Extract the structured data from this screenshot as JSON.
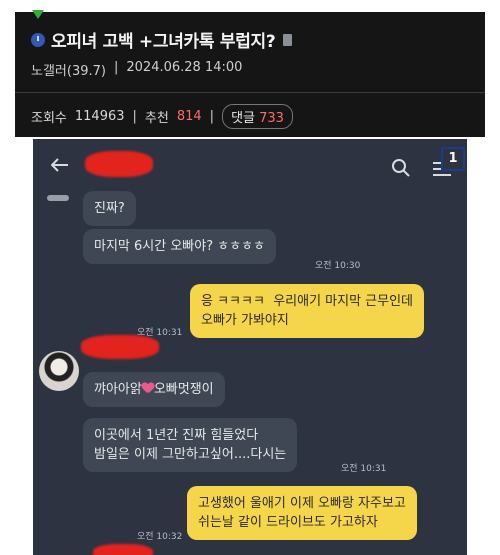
{
  "post": {
    "title": "오피녀 고백 +그녀카톡 부럽지?",
    "author": "노갤러(39.7)",
    "separator": "|",
    "datetime": "2024.06.28 14:00",
    "views_label": "조회수",
    "views": "114963",
    "recommend_label": "추천",
    "recommend": "814",
    "comments_label": "댓글",
    "comments": "733"
  },
  "chat": {
    "badge": "1",
    "messages": [
      {
        "text": "진짜?",
        "time": ""
      },
      {
        "text": "마지막 6시간 오빠야? ㅎㅎㅎㅎ",
        "time": "오전 10:30"
      },
      {
        "text": "응 ㅋㅋㅋㅋ  우리애기 마지막 근무인데\n오빠가 가봐야지",
        "time": "오전 10:31"
      },
      {
        "text_before": "꺄아아앍",
        "text_after": "오빠멋쟁이",
        "time": ""
      },
      {
        "text": "이곳에서 1년간 진짜 힘들었다\n밤일은 이제 그만하고싶어....다시는",
        "time": "오전 10:31"
      },
      {
        "text": "고생했어 울애기 이제 오빠랑 자주보고\n쉬는날 같이 드라이브도 가고하자",
        "time": "오전 10:32"
      }
    ]
  },
  "colors": {
    "header_bg": "#151515",
    "chat_bg": "#2d3340",
    "my_bubble": "#f5d64a",
    "other_bubble": "#3f4654",
    "accent_red": "#ff6b6b"
  }
}
